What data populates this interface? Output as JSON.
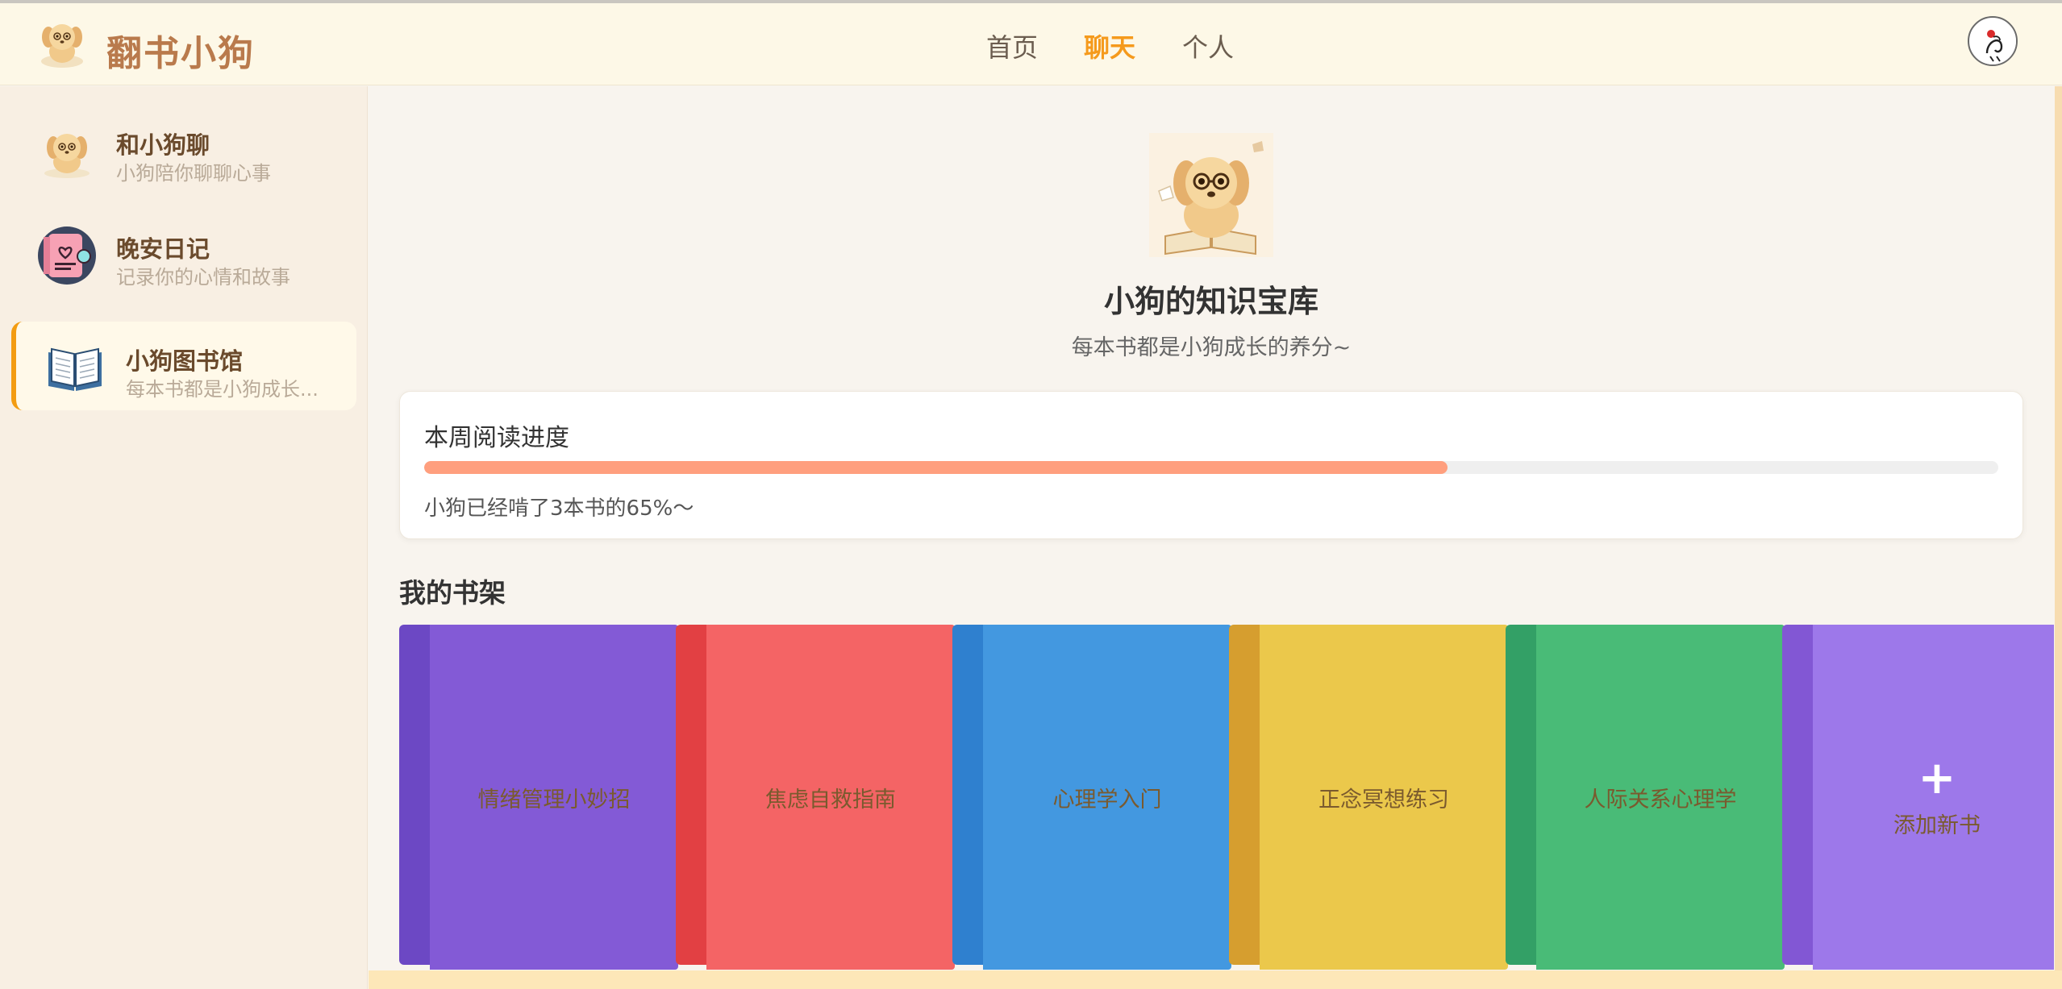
{
  "app": {
    "title": "翻书小狗"
  },
  "nav": {
    "items": [
      "首页",
      "聊天",
      "个人"
    ],
    "active": "聊天"
  },
  "sidebar": {
    "items": [
      {
        "title": "和小狗聊",
        "subtitle": "小狗陪你聊聊心事",
        "icon": "puppy-icon"
      },
      {
        "title": "晚安日记",
        "subtitle": "记录你的心情和故事",
        "icon": "diary-icon"
      },
      {
        "title": "小狗图书馆",
        "subtitle": "每本书都是小狗成长...",
        "icon": "open-book-icon",
        "active": true
      }
    ]
  },
  "hero": {
    "title": "小狗的知识宝库",
    "subtitle": "每本书都是小狗成长的养分~"
  },
  "progress": {
    "title": "本周阅读进度",
    "percent": 65,
    "text": "小狗已经啃了3本书的65%～"
  },
  "shelf": {
    "title": "我的书架",
    "books": [
      {
        "title": "情绪管理小妙招",
        "spine": "#6c48c4",
        "cover": "#835ad6"
      },
      {
        "title": "焦虑自救指南",
        "spine": "#e24043",
        "cover": "#f46465"
      },
      {
        "title": "心理学入门",
        "spine": "#2f80cf",
        "cover": "#4398e0"
      },
      {
        "title": "正念冥想练习",
        "spine": "#d69e2f",
        "cover": "#ebc84b"
      },
      {
        "title": "人际关系心理学",
        "spine": "#33a066",
        "cover": "#49bb77"
      }
    ],
    "add_book": {
      "label": "添加新书",
      "plus": "+",
      "spine": "#8257d4",
      "cover": "#9d78ea"
    }
  },
  "colors": {
    "accent": "#f59a1c",
    "header_bg": "#fdf8e7",
    "sidebar_bg": "#f8efe3",
    "progress_fill": "#ff9f7e"
  }
}
